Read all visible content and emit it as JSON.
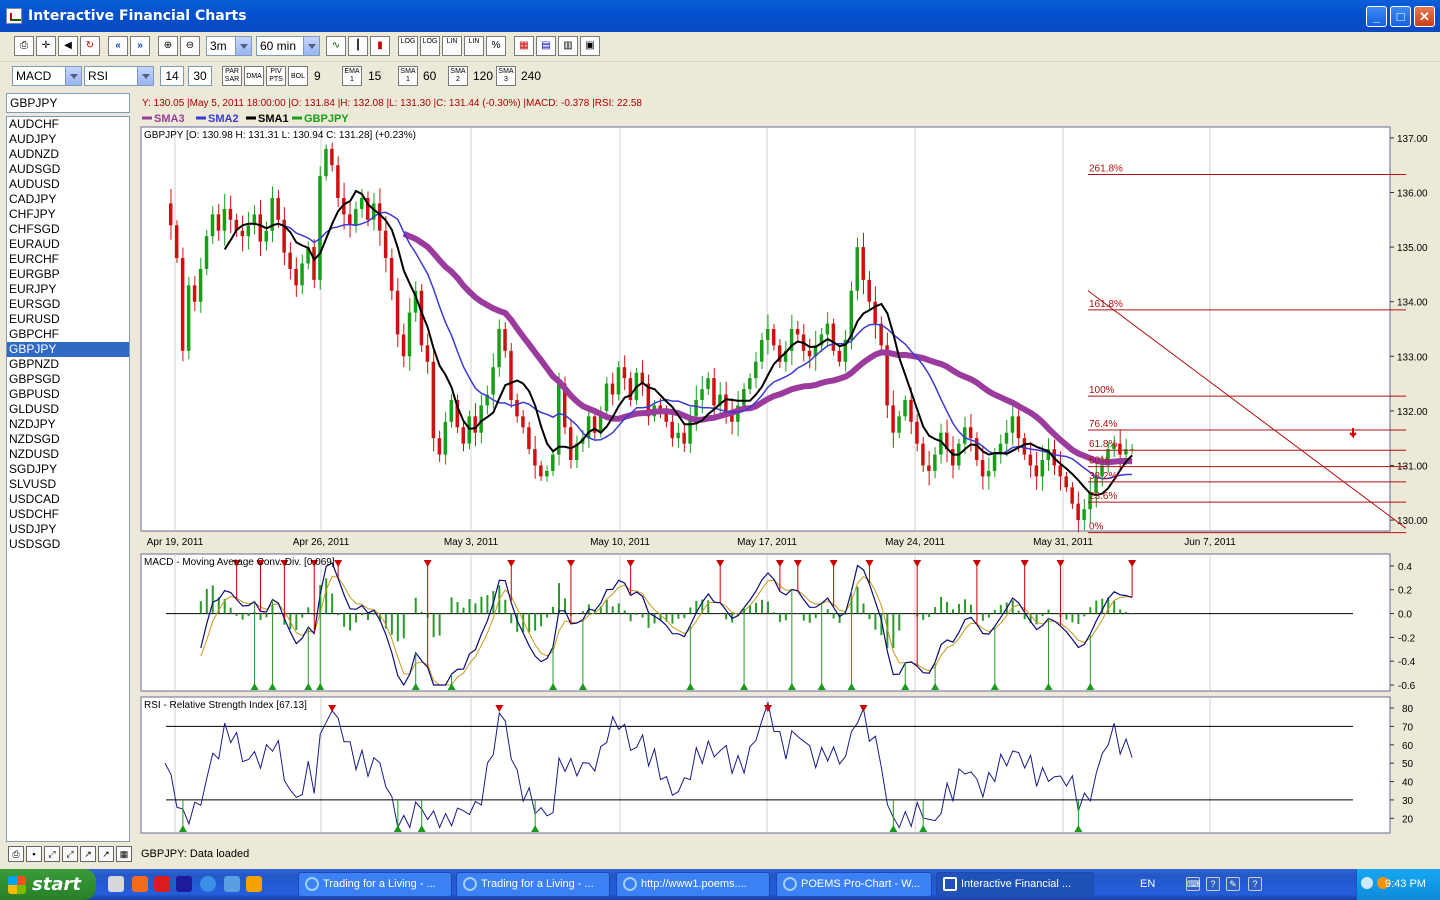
{
  "window": {
    "title": "Interactive Financial Charts"
  },
  "toolbar": {
    "period": "3m",
    "interval": "60 min",
    "buttons": [
      "LOG",
      "LOG",
      "LIN",
      "LIN",
      "%"
    ]
  },
  "indicators": {
    "ind1": "MACD",
    "ind2": "RSI",
    "macd_fast": "14",
    "macd_slow": "30",
    "par_sar": "PAR SAR",
    "dma": "DMA",
    "piv_pts": "PIV PTS",
    "bol": "BOL",
    "bol_val": "9",
    "ema": "EMA 1",
    "ema_val": "15",
    "sma1": "SMA 1",
    "sma1_val": "60",
    "sma2": "SMA 2",
    "sma2_val": "120",
    "sma3": "SMA 3",
    "sma3_val": "240"
  },
  "symbol": {
    "current": "GBPJPY"
  },
  "symbols": [
    "AUDCHF",
    "AUDJPY",
    "AUDNZD",
    "AUDSGD",
    "AUDUSD",
    "CADJPY",
    "CHFJPY",
    "CHFSGD",
    "EURAUD",
    "EURCHF",
    "EURGBP",
    "EURJPY",
    "EURSGD",
    "EURUSD",
    "GBPCHF",
    "GBPJPY",
    "GBPNZD",
    "GBPSGD",
    "GBPUSD",
    "GLDUSD",
    "NZDJPY",
    "NZDSGD",
    "NZDUSD",
    "SGDJPY",
    "SLVUSD",
    "USDCAD",
    "USDCHF",
    "USDJPY",
    "USDSGD"
  ],
  "selected_symbol_index": 15,
  "info_line": "Y: 130.05 |May 5, 2011 18:00:00 |O: 131.84 |H: 132.08 |L: 131.30 |C: 131.44 (-0.30%) |MACD: -0.378 |RSI: 22.58",
  "ohlc_label": "GBPJPY [O: 130.98  H: 131.31  L: 130.94  C: 131.28] (+0.23%)",
  "colors": {
    "sma3": "#9b3b9e",
    "sma2": "#3a3ad4",
    "sma1": "#000000",
    "price_up": "#17a017",
    "price_down": "#d01010",
    "fib": "#b01010",
    "macd": "#0b0b7a",
    "signal": "#c49a1a",
    "rsi": "#1a1a8a"
  },
  "chart_data": [
    {
      "type": "line",
      "title": "GBPJPY",
      "legend": [
        "SMA3",
        "SMA2",
        "SMA1",
        "GBPJPY"
      ],
      "x_ticks": [
        "Apr 19, 2011",
        "Apr 26, 2011",
        "May 3, 2011",
        "May 10, 2011",
        "May 17, 2011",
        "May 24, 2011",
        "May 31, 2011",
        "Jun 7, 2011"
      ],
      "ylim": [
        129.8,
        137.2
      ],
      "y_ticks": [
        130.0,
        131.0,
        132.0,
        133.0,
        134.0,
        135.0,
        136.0,
        137.0
      ],
      "y_tick_labels": [
        "130.00",
        "131.00",
        "132.00",
        "133.00",
        "134.00",
        "135.00",
        "136.00",
        "137.00"
      ],
      "price": {
        "name": "GBPJPY",
        "x": [
          0,
          1,
          2,
          3,
          4,
          5,
          6,
          7,
          8,
          9,
          10,
          11,
          12,
          13,
          14,
          15,
          16,
          17,
          18,
          19,
          20,
          21,
          22,
          23,
          24,
          25,
          26,
          27,
          28,
          29,
          30,
          31,
          32,
          33,
          34,
          35,
          36,
          37,
          38,
          39,
          40,
          41,
          42,
          43,
          44,
          45,
          46,
          47,
          48,
          49,
          50,
          51,
          52,
          53,
          54,
          55,
          56,
          57,
          58,
          59,
          60,
          61,
          62,
          63,
          64,
          65,
          66,
          67,
          68,
          69,
          70,
          71,
          72,
          73,
          74,
          75,
          76,
          77,
          78,
          79,
          80,
          81,
          82,
          83,
          84,
          85,
          86,
          87,
          88,
          89,
          90,
          91,
          92,
          93,
          94,
          95,
          96,
          97,
          98,
          99,
          100,
          101,
          102,
          103,
          104,
          105,
          106,
          107,
          108,
          109,
          110,
          111,
          112,
          113,
          114,
          115,
          116,
          117,
          118,
          119,
          120,
          121,
          122,
          123,
          124,
          125,
          126,
          127,
          128,
          129,
          130,
          131,
          132,
          133,
          134,
          135,
          136,
          137,
          138,
          139,
          140,
          141,
          142,
          143,
          144,
          145,
          146,
          147,
          148,
          149,
          150,
          151,
          152,
          153,
          154,
          155,
          156,
          157,
          158,
          159,
          160,
          161,
          162,
          163,
          164,
          165,
          166,
          167,
          168,
          169,
          170,
          171,
          172,
          173,
          174,
          175,
          176,
          177,
          178,
          179,
          180,
          181,
          182,
          183,
          184,
          185,
          186,
          187,
          188,
          189,
          190,
          191,
          192,
          193,
          194,
          195,
          196,
          197,
          198,
          199
        ],
        "y": [
          135.8,
          135.4,
          134.8,
          133.1,
          134.3,
          134.0,
          134.6,
          135.2,
          135.6,
          135.3,
          135.7,
          135.5,
          135.3,
          135.2,
          135.4,
          135.6,
          135.1,
          135.3,
          135.9,
          135.5,
          134.9,
          134.6,
          134.3,
          134.7,
          135.0,
          134.4,
          136.3,
          136.8,
          136.5,
          135.9,
          135.6,
          135.4,
          135.7,
          135.9,
          135.5,
          135.8,
          135.3,
          134.8,
          134.2,
          133.4,
          133.0,
          133.8,
          134.2,
          133.2,
          132.9,
          131.5,
          131.2,
          131.8,
          132.2,
          131.7,
          131.4,
          131.9,
          131.6,
          132.1,
          132.3,
          132.8,
          133.5,
          133.1,
          132.2,
          131.9,
          131.7,
          131.3,
          131.0,
          130.8,
          130.9,
          131.2,
          132.5,
          131.7,
          131.1,
          131.4,
          131.5,
          131.9,
          131.6,
          132.0,
          132.5,
          132.3,
          132.8,
          132.6,
          132.2,
          132.7,
          132.5,
          131.9,
          132.1,
          132.0,
          131.8,
          131.5,
          131.6,
          131.4,
          131.9,
          132.2,
          132.4,
          132.6,
          132.1,
          132.3,
          132.0,
          131.8,
          132.1,
          132.4,
          132.6,
          132.9,
          133.3,
          133.5,
          133.2,
          132.9,
          133.1,
          133.5,
          133.4,
          133.1,
          133.0,
          133.2,
          133.4,
          133.6,
          133.1,
          132.9,
          133.3,
          134.2,
          135.0,
          134.4,
          134.0,
          133.6,
          133.2,
          132.1,
          131.6,
          131.9,
          132.2,
          131.8,
          131.4,
          131.0,
          130.9,
          131.2,
          131.6,
          131.3,
          131.0,
          131.4,
          131.7,
          131.5,
          131.1,
          130.8,
          130.9,
          131.2,
          131.4,
          131.6,
          131.9,
          131.5,
          131.2,
          131.0,
          130.8,
          131.1,
          131.3,
          131.0,
          130.8,
          130.6,
          130.3,
          130.0,
          130.2,
          130.5,
          130.8,
          131.0,
          131.3,
          131.4,
          131.2,
          131.3,
          131.3,
          131.3,
          131.3,
          131.3,
          131.3,
          131.3,
          131.3,
          131.3,
          131.3,
          131.3,
          131.3,
          131.3,
          131.3,
          131.3,
          131.3,
          131.3,
          131.3,
          131.3,
          131.3,
          131.3,
          131.3,
          131.3,
          131.3,
          131.3,
          131.3,
          131.3,
          131.3,
          131.3,
          131.3,
          131.3,
          131.3,
          131.3,
          131.3,
          131.3,
          131.3,
          131.3,
          131.3,
          131.3
        ]
      },
      "fib_levels": [
        {
          "label": "261.8%",
          "value": 136.33
        },
        {
          "label": "161.8%",
          "value": 133.85
        },
        {
          "label": "100%",
          "value": 132.27
        },
        {
          "label": "76.4%",
          "value": 131.65
        },
        {
          "label": "61.8%",
          "value": 131.28
        },
        {
          "label": "50%",
          "value": 130.98
        },
        {
          "label": "38.2%",
          "value": 130.7
        },
        {
          "label": "23.6%",
          "value": 130.33
        },
        {
          "label": "0%",
          "value": 129.77
        }
      ]
    },
    {
      "type": "line",
      "title": "MACD - Moving Average Conv. Div. [0.069]",
      "ylim": [
        -0.65,
        0.5
      ],
      "y_ticks": [
        0.4,
        0.2,
        0.0,
        -0.2,
        -0.4,
        -0.6
      ],
      "y_tick_labels": [
        "0.4",
        "0.2",
        "0.0",
        "-0.2",
        "-0.4",
        "-0.6"
      ]
    },
    {
      "type": "line",
      "title": "RSI - Relative Strength Index [67.13]",
      "ylim": [
        12,
        86
      ],
      "y_ticks": [
        80,
        70,
        60,
        50,
        40,
        30,
        20
      ],
      "y_tick_labels": [
        "80",
        "70",
        "60",
        "50",
        "40",
        "30",
        "20"
      ],
      "overbought": 70,
      "oversold": 30
    }
  ],
  "status": {
    "message": "GBPJPY: Data loaded"
  },
  "taskbar": {
    "start": "start",
    "tasks": [
      "Trading for a Living - ...",
      "Trading for a Living - ...",
      "http://www1.poems....",
      "POEMS Pro-Chart - W...",
      "Interactive Financial ..."
    ],
    "lang": "EN",
    "clock": "9:43 PM"
  }
}
